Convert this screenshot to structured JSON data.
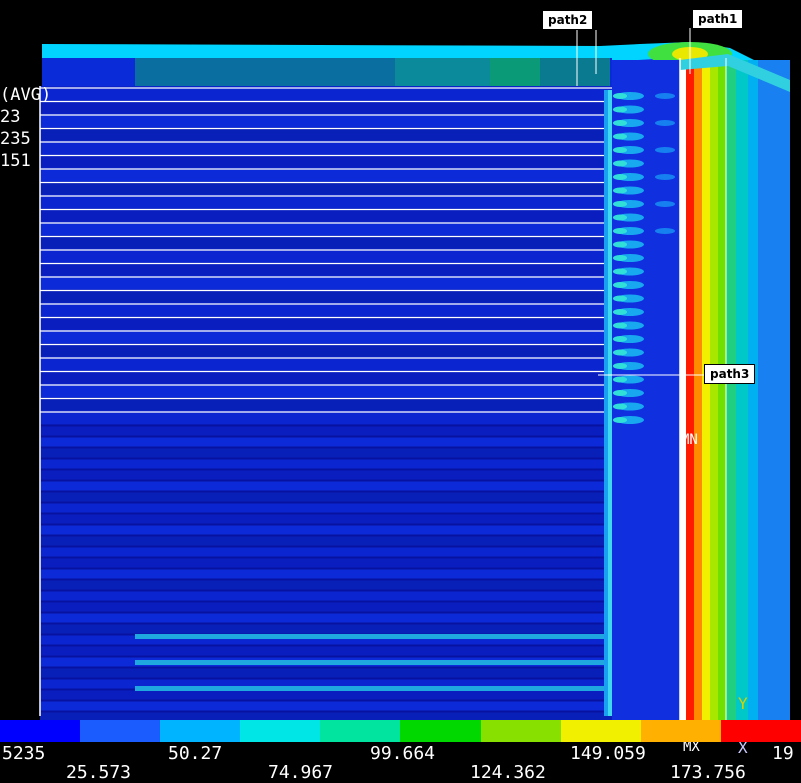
{
  "contour": {
    "legend_header": "(AVG)",
    "legend_lines": [
      "23",
      "235",
      "151"
    ]
  },
  "paths": {
    "path1": "path1",
    "path2": "path2",
    "path3": "path3"
  },
  "markers": {
    "min": "MN",
    "max": "MX"
  },
  "axes": {
    "y": "Y",
    "x": "X"
  },
  "colorbar": {
    "colors": [
      "#0000ff",
      "#1b5cff",
      "#00b4ff",
      "#00e6e6",
      "#00e4a0",
      "#00d800",
      "#88e000",
      "#f0f000",
      "#ffb000",
      "#ff0000"
    ],
    "upper_ticks": [
      "5235",
      "50.27",
      "99.664",
      "149.059",
      "19"
    ],
    "lower_ticks": [
      "25.573",
      "74.967",
      "124.362",
      "173.756"
    ]
  }
}
